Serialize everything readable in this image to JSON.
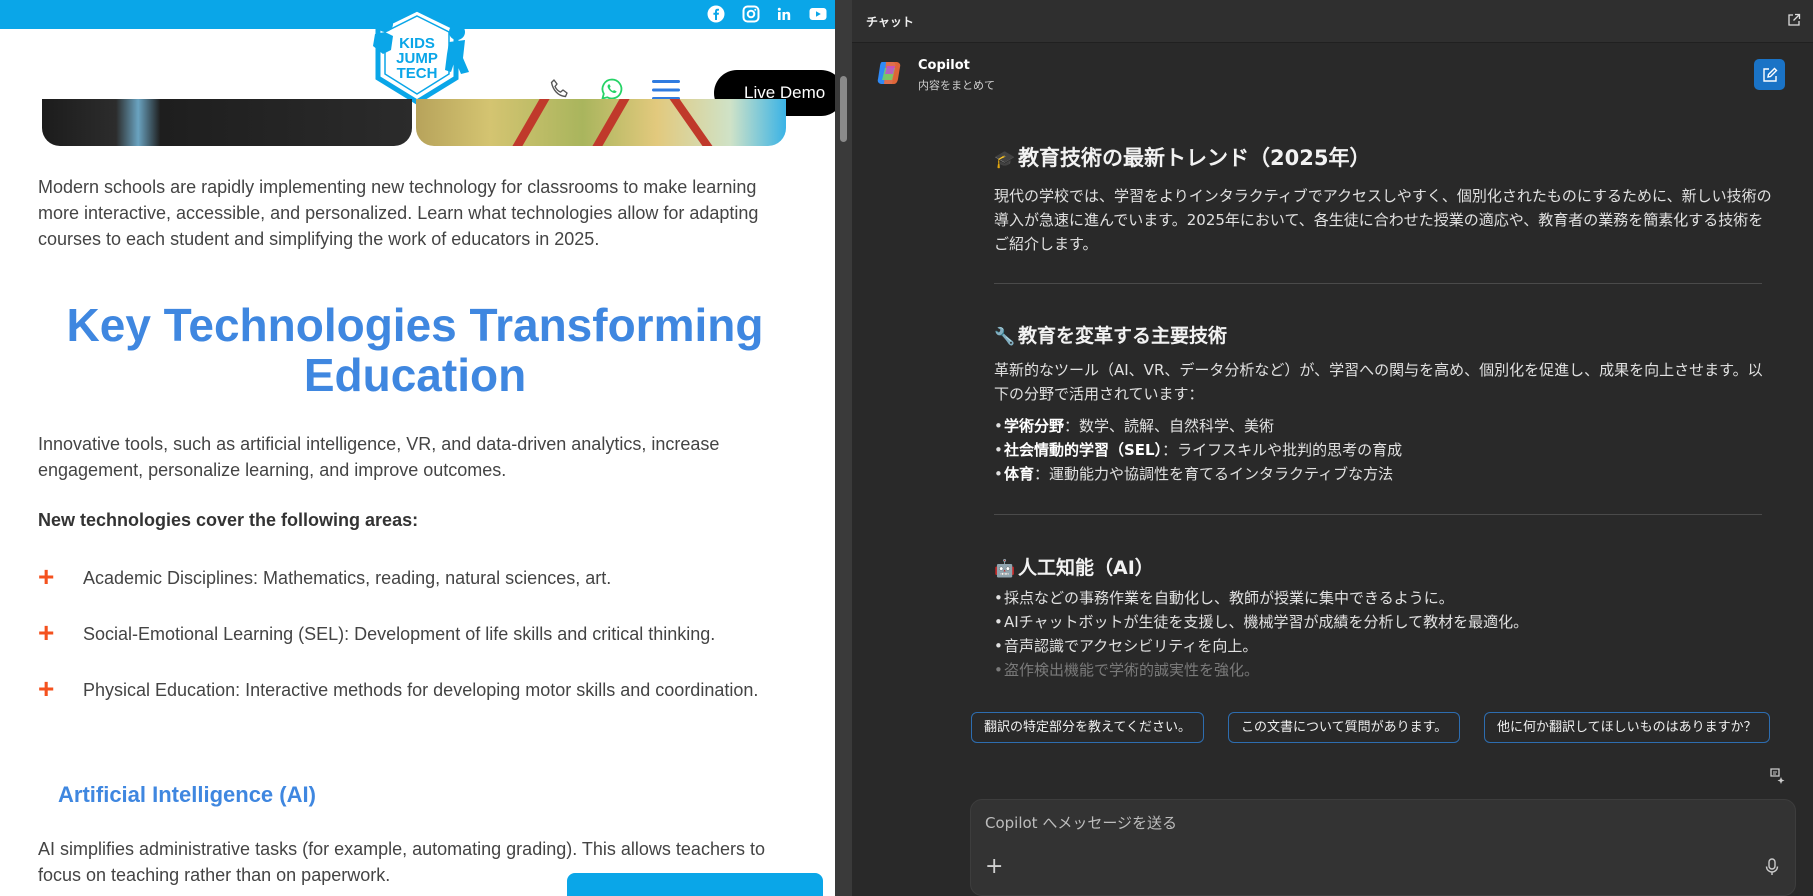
{
  "site": {
    "logo_lines": [
      "KIDS",
      "JUMP",
      "TECH"
    ],
    "social_icons": [
      "facebook-icon",
      "instagram-icon",
      "linkedin-icon",
      "youtube-icon"
    ],
    "demo_label": "Live Demo",
    "intro": "Modern schools are rapidly implementing new technology for classrooms to make learning more interactive, accessible, and personalized. Learn what technologies allow for adapting courses to each student and simplifying the work of educators in 2025.",
    "heading": "Key Technologies Transforming Education",
    "para2": "Innovative tools, such as artificial intelligence, VR, and data-driven analytics, increase engagement, personalize learning, and improve outcomes.",
    "bold_line": "New technologies cover the following areas:",
    "list": [
      "Academic Disciplines: Mathematics, reading, natural sciences, art.",
      "Social-Emotional Learning (SEL): Development of life skills and critical thinking.",
      "Physical Education: Interactive methods for developing motor skills and coordination."
    ],
    "subheading": "Artificial Intelligence (AI)",
    "para3": "AI simplifies administrative tasks (for example, automating grading). This allows teachers to focus on teaching rather than on paperwork.",
    "brand_color": "#0aa6e8",
    "accent_color": "#3f87e0"
  },
  "chat": {
    "pane_title": "チャット",
    "agent_name": "Copilot",
    "agent_status": "内容をまとめて",
    "sec1_title": "教育技術の最新トレンド（2025年）",
    "sec1_body": "現代の学校では、学習をよりインタラクティブでアクセスしやすく、個別化されたものにするために、新しい技術の導入が急速に進んでいます。2025年において、各生徒に合わせた授業の適応や、教育者の業務を簡素化する技術をご紹介します。",
    "sec2_title": "教育を変革する主要技術",
    "sec2_body": "革新的なツール（AI、VR、データ分析など）が、学習への関与を高め、個別化を促進し、成果を向上させます。以下の分野で活用されています：",
    "sec2_items": [
      {
        "term": "学術分野",
        "desc": "：数学、読解、自然科学、美術"
      },
      {
        "term": "社会情動的学習（SEL）",
        "desc": "：ライフスキルや批判的思考の育成"
      },
      {
        "term": "体育",
        "desc": "：運動能力や協調性を育てるインタラクティブな方法"
      }
    ],
    "sec3_title": "人工知能（AI）",
    "sec3_items": [
      "採点などの事務作業を自動化し、教師が授業に集中できるように。",
      "AIチャットボットが生徒を支援し、機械学習が成績を分析して教材を最適化。",
      "音声認識でアクセシビリティを向上。",
      "盗作検出機能で学術的誠実性を強化。"
    ],
    "suggestions": [
      "翻訳の特定部分を教えてください。",
      "この文書について質問があります。",
      "他に何か翻訳してほしいものはありますか？"
    ],
    "input_placeholder": "Copilot へメッセージを送る",
    "accent_color": "#1a73c6"
  }
}
